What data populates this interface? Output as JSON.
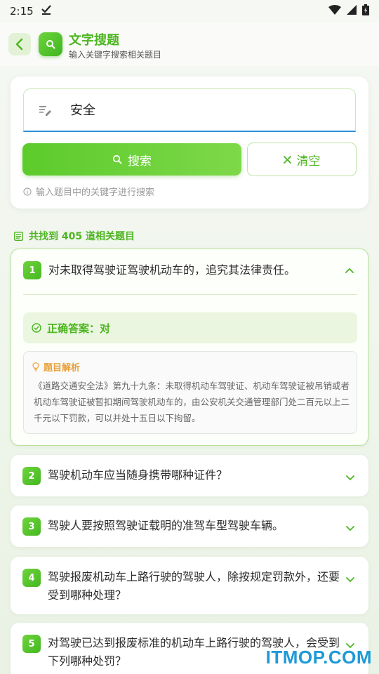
{
  "status_bar": {
    "time": "2:15"
  },
  "header": {
    "title": "文字搜题",
    "subtitle": "输入关键字搜索相关题目"
  },
  "search": {
    "value": "安全",
    "search_label": "搜索",
    "clear_label": "清空",
    "hint": "输入题目中的关键字进行搜索"
  },
  "results": {
    "count_text": "共找到 405 道相关题目",
    "items": [
      {
        "num": "1",
        "question": "对未取得驾驶证驾驶机动车的，追究其法律责任。",
        "expanded": true,
        "answer": "正确答案：对",
        "analysis_title": "题目解析",
        "analysis": "《道路交通安全法》第九十九条：未取得机动车驾驶证、机动车驾驶证被吊销或者机动车驾驶证被暂扣期间驾驶机动车的，由公安机关交通管理部门处二百元以上二千元以下罚款，可以并处十五日以下拘留。"
      },
      {
        "num": "2",
        "question": "驾驶机动车应当随身携带哪种证件？"
      },
      {
        "num": "3",
        "question": "驾驶人要按照驾驶证载明的准驾车型驾驶车辆。"
      },
      {
        "num": "4",
        "question": "驾驶报废机动车上路行驶的驾驶人，除按规定罚款外，还要受到哪种处理？"
      },
      {
        "num": "5",
        "question": "对驾驶已达到报废标准的机动车上路行驶的驾驶人，会受到下列哪种处罚？"
      }
    ]
  },
  "watermark": "ITMOP.COM",
  "colors": {
    "accent": "#4cb520",
    "underline": "#2f8fd8",
    "analysis_title": "#e8a13a"
  }
}
